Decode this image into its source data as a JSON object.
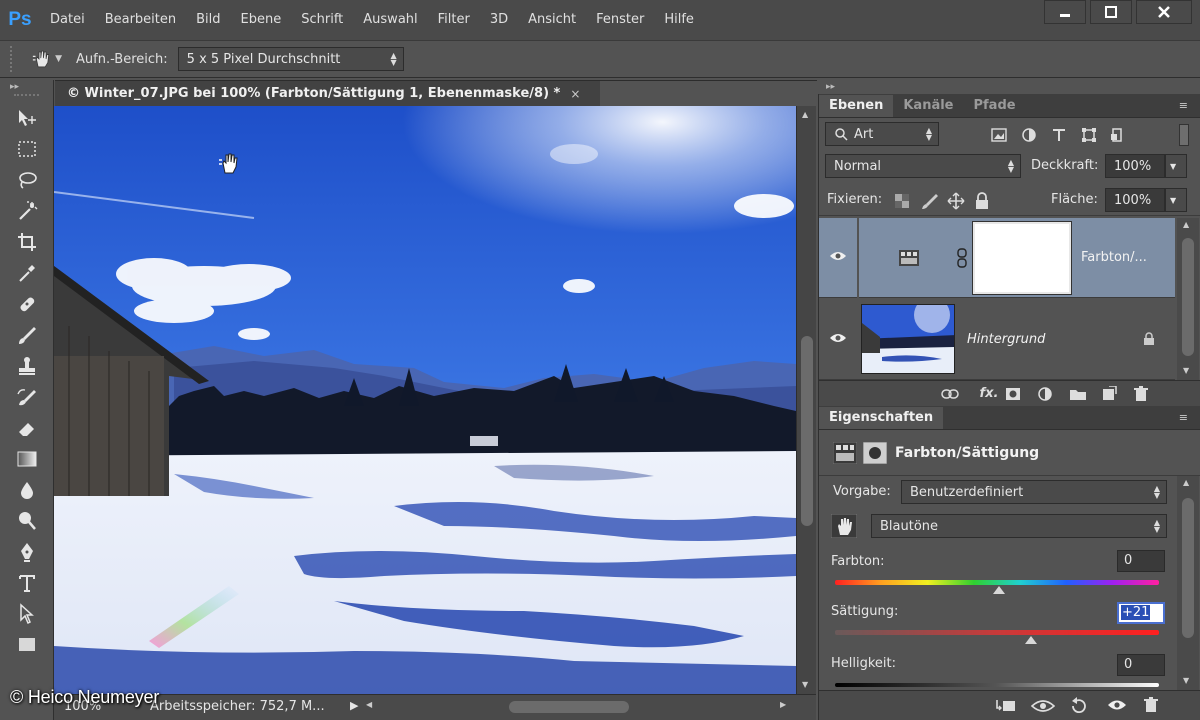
{
  "app": {
    "logo": "Ps"
  },
  "menu": [
    "Datei",
    "Bearbeiten",
    "Bild",
    "Ebene",
    "Schrift",
    "Auswahl",
    "Filter",
    "3D",
    "Ansicht",
    "Fenster",
    "Hilfe"
  ],
  "options": {
    "sample_label": "Aufn.-Bereich:",
    "sample_value": "5 x 5 Pixel Durchschnitt"
  },
  "document": {
    "tab_title": "© Winter_07.JPG bei 100% (Farbton/Sättigung 1, Ebenenmaske/8) *",
    "close": "×"
  },
  "status": {
    "zoom": "100%",
    "info": "Arbeitsspeicher: 752,7 M..."
  },
  "watermark": "© Heico Neumeyer",
  "layers_panel": {
    "tabs": [
      "Ebenen",
      "Kanäle",
      "Pfade"
    ],
    "filter_label": "Art",
    "blend_mode": "Normal",
    "opacity_label": "Deckkraft:",
    "opacity_value": "100%",
    "lock_label": "Fixieren:",
    "fill_label": "Fläche:",
    "fill_value": "100%",
    "layers": [
      {
        "name": "Farbton/...",
        "selected": true
      },
      {
        "name": "Hintergrund",
        "selected": false
      }
    ]
  },
  "properties_panel": {
    "tab": "Eigenschaften",
    "title": "Farbton/Sättigung",
    "preset_label": "Vorgabe:",
    "preset_value": "Benutzerdefiniert",
    "channel_value": "Blautöne",
    "hue_label": "Farbton:",
    "hue_value": "0",
    "saturation_label": "Sättigung:",
    "saturation_value": "+21",
    "lightness_label": "Helligkeit:",
    "lightness_value": "0"
  },
  "colors": {
    "selected_layer": "#7d8ea5",
    "accent": "#3aa0ff"
  }
}
